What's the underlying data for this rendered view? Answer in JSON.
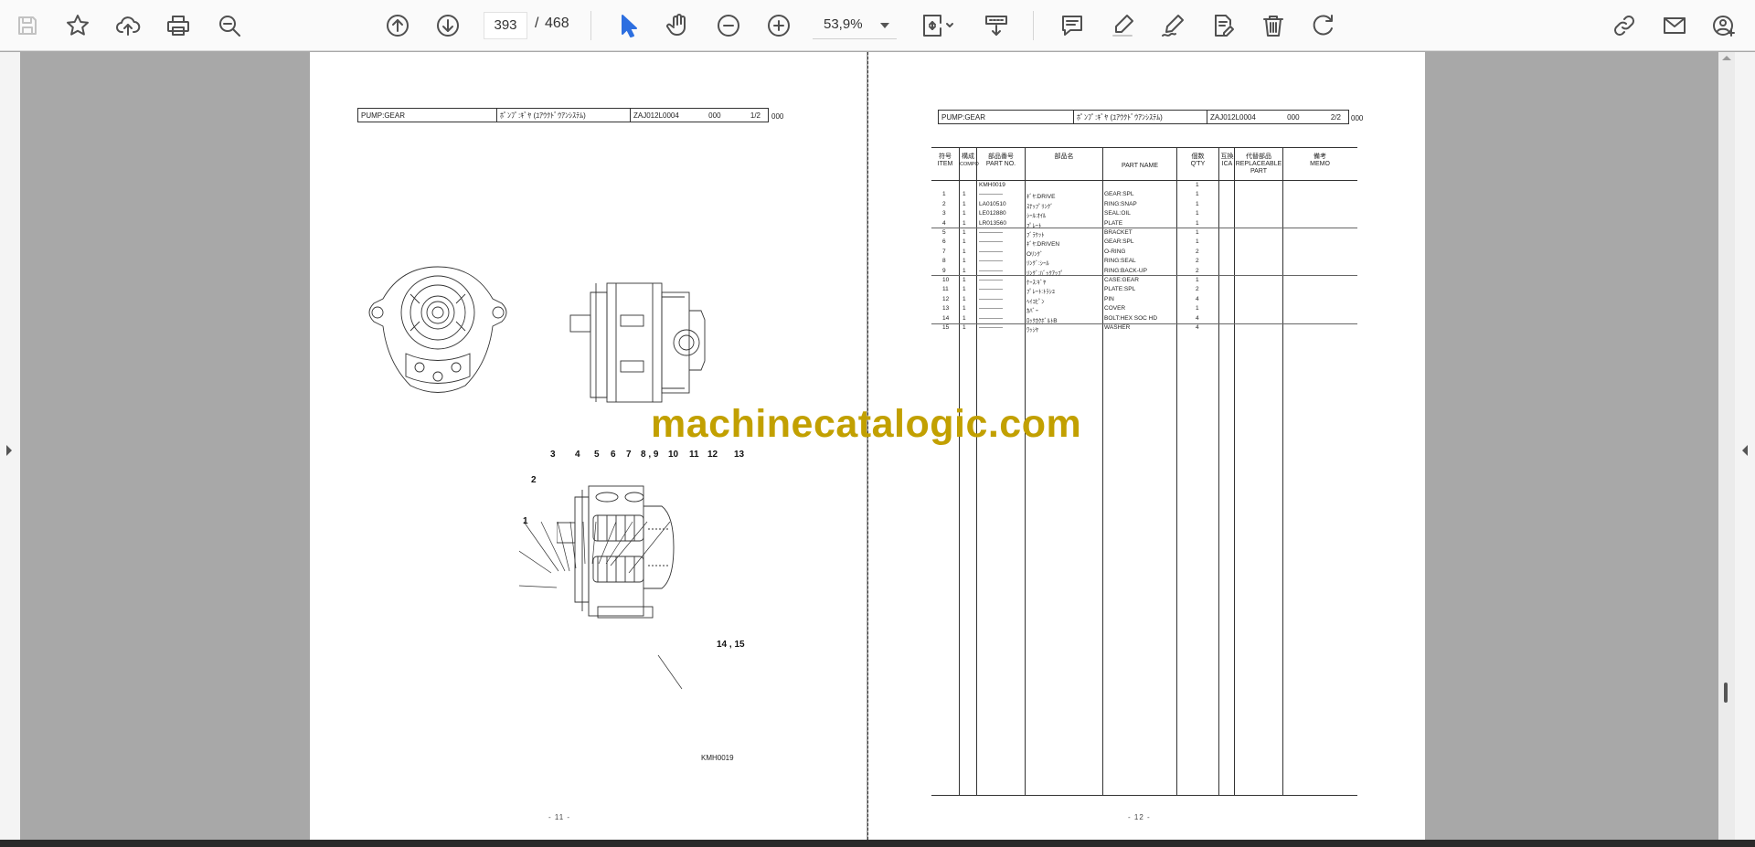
{
  "toolbar": {
    "current_page": "393",
    "page_separator": "/",
    "total_pages": "468",
    "zoom": "53,9%"
  },
  "watermark": "machinecatalogic.com",
  "left_page": {
    "header": {
      "title": "PUMP:GEAR",
      "jp_title": "ﾎﾟﾝﾌﾟ:ｷﾞﾔ (ﾕｱｳｸﾄﾞｳｱﾝｼｽﾃﾑ)",
      "code": "ZAJ012L0004",
      "rev": "000",
      "sheet": "1/2",
      "tail": "000"
    },
    "callouts": [
      "3",
      "4",
      "5",
      "6",
      "7",
      "8 , 9",
      "10",
      "11",
      "12",
      "13",
      "2",
      "1",
      "14 , 15"
    ],
    "diagram_code": "KMH0019",
    "page_number": "- 11 -"
  },
  "right_page": {
    "header": {
      "title": "PUMP:GEAR",
      "jp_title": "ﾎﾟﾝﾌﾟ:ｷﾞﾔ (ﾕｱｳｸﾄﾞｳｱﾝｼｽﾃﾑ)",
      "code": "ZAJ012L0004",
      "rev": "000",
      "sheet": "2/2",
      "tail": "000"
    },
    "columns": {
      "item": [
        "符号",
        "ITEM"
      ],
      "compo": [
        "構成",
        "COMPO"
      ],
      "part_no": [
        "部品番号",
        "PART NO."
      ],
      "jp_name": [
        "部品名"
      ],
      "part_name": [
        "PART NAME"
      ],
      "qty": [
        "個数",
        "Q'TY"
      ],
      "ica": [
        "互換",
        "ICA"
      ],
      "replaceable": [
        "代替部品",
        "REPLACEABLE",
        "PART"
      ],
      "memo": [
        "備考",
        "MEMO"
      ]
    },
    "rows": [
      {
        "item": "",
        "compo": "",
        "part_no": "KMH0019",
        "jp": "",
        "name": "",
        "qty": "1"
      },
      {
        "item": "1",
        "compo": "1",
        "part_no": "————",
        "jp": "ｷﾞﾔ:DRIVE",
        "name": "GEAR:SPL",
        "qty": "1"
      },
      {
        "item": "2",
        "compo": "1",
        "part_no": "LA010510",
        "jp": "ｽﾅｯﾌﾟﾘﾝｸﾞ",
        "name": "RING:SNAP",
        "qty": "1"
      },
      {
        "item": "3",
        "compo": "1",
        "part_no": "LE012880",
        "jp": "ｼｰﾙ:ｵｲﾙ",
        "name": "SEAL:OIL",
        "qty": "1"
      },
      {
        "item": "4",
        "compo": "1",
        "part_no": "LR013560",
        "jp": "ﾌﾟﾚｰﾄ",
        "name": "PLATE",
        "qty": "1"
      },
      {
        "item": "5",
        "compo": "1",
        "part_no": "————",
        "jp": "ﾌﾞﾗｹｯﾄ",
        "name": "BRACKET",
        "qty": "1"
      },
      {
        "item": "6",
        "compo": "1",
        "part_no": "————",
        "jp": "ｷﾞﾔ:DRIVEN",
        "name": "GEAR:SPL",
        "qty": "1"
      },
      {
        "item": "7",
        "compo": "1",
        "part_no": "————",
        "jp": "Oﾘﾝｸﾞ",
        "name": "O-RING",
        "qty": "2"
      },
      {
        "item": "8",
        "compo": "1",
        "part_no": "————",
        "jp": "ﾘﾝｸﾞ:ｼｰﾙ",
        "name": "RING:SEAL",
        "qty": "2"
      },
      {
        "item": "9",
        "compo": "1",
        "part_no": "————",
        "jp": "ﾘﾝｸﾞ:ﾊﾞｯｸｱｯﾌﾟ",
        "name": "RING:BACK-UP",
        "qty": "2"
      },
      {
        "item": "10",
        "compo": "1",
        "part_no": "————",
        "jp": "ｹｰｽ:ｷﾞﾔ",
        "name": "CASE:GEAR",
        "qty": "1"
      },
      {
        "item": "11",
        "compo": "1",
        "part_no": "————",
        "jp": "ﾌﾟﾚｰﾄ:ﾄﾗｼﾕ",
        "name": "PLATE:SPL",
        "qty": "2"
      },
      {
        "item": "12",
        "compo": "1",
        "part_no": "————",
        "jp": "ﾍｲｺﾋﾟﾝ",
        "name": "PIN",
        "qty": "4"
      },
      {
        "item": "13",
        "compo": "1",
        "part_no": "————",
        "jp": "ｶﾊﾞｰ",
        "name": "COVER",
        "qty": "1"
      },
      {
        "item": "14",
        "compo": "1",
        "part_no": "————",
        "jp": "ﾛｯｸｶｸﾎﾞﾙﾄB",
        "name": "BOLT:HEX SOC HD",
        "qty": "4"
      },
      {
        "item": "15",
        "compo": "1",
        "part_no": "————",
        "jp": "ﾜｯｼﾔ",
        "name": "WASHER",
        "qty": "4"
      }
    ],
    "page_number": "- 12 -"
  }
}
